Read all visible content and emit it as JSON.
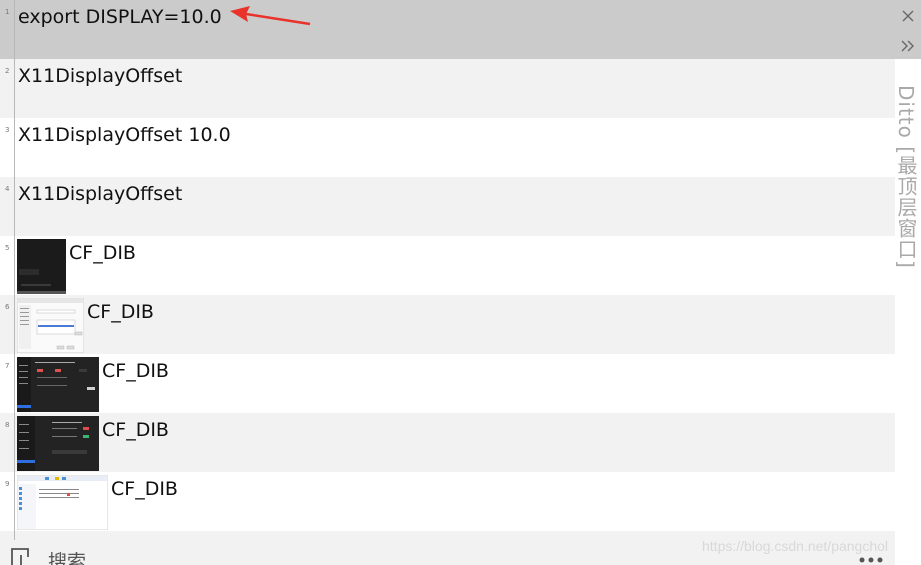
{
  "clips": [
    {
      "num": "1",
      "text": "export DISPLAY=10.0",
      "type": "text",
      "selected": true
    },
    {
      "num": "2",
      "text": "X11DisplayOffset",
      "type": "text"
    },
    {
      "num": "3",
      "text": "X11DisplayOffset 10.0",
      "type": "text"
    },
    {
      "num": "4",
      "text": "X11DisplayOffset",
      "type": "text"
    },
    {
      "num": "5",
      "text": "CF_DIB",
      "type": "image"
    },
    {
      "num": "6",
      "text": "CF_DIB",
      "type": "image"
    },
    {
      "num": "7",
      "text": "CF_DIB",
      "type": "image"
    },
    {
      "num": "8",
      "text": "CF_DIB",
      "type": "image"
    },
    {
      "num": "9",
      "text": "CF_DIB",
      "type": "image"
    }
  ],
  "sidebar": {
    "title": "Ditto [最顶层窗口]",
    "close_icon": "close-icon",
    "expand_icon": "double-chevron-right-icon"
  },
  "bottom": {
    "search_placeholder": "搜索",
    "more_icon": "ellipsis-icon"
  },
  "watermark": "https://blog.csdn.net/pangchol",
  "colors": {
    "selected_row": "#cbcbcb",
    "odd_row": "#f2f2f2",
    "even_row": "#ffffff",
    "arrow": "#e8322a",
    "sidebar_text": "#a9a9a9"
  }
}
